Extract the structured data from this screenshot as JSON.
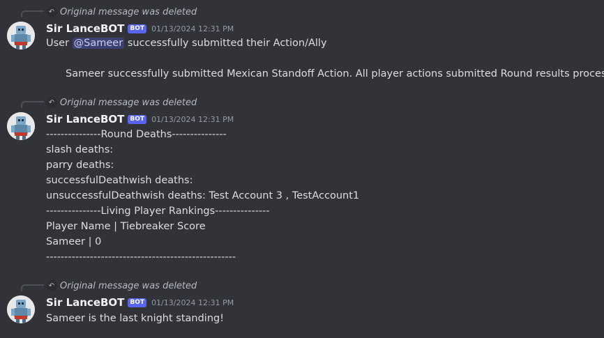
{
  "deleted_label": "Original message was deleted",
  "bot_tag": "BOT",
  "messages": [
    {
      "author": "Sir LanceBOT",
      "timestamp": "01/13/2024 12:31 PM",
      "intro_pre": "User",
      "mention": "@Sameer",
      "intro_post": "successfully submitted their Action/Ally",
      "detail": "Sameer successfully submitted Mexican Standoff Action. All player actions submitted Round results processed"
    },
    {
      "author": "Sir LanceBOT",
      "timestamp": "01/13/2024 12:31 PM",
      "lines": [
        "---------------Round Deaths---------------",
        "slash deaths:",
        "parry deaths:",
        "successfulDeathwish deaths:",
        "unsuccessfulDeathwish deaths:  Test Account 3 , TestAccount1",
        "---------------Living Player Rankings---------------",
        "Player Name | Tiebreaker Score",
        "Sameer | 0",
        "----------------------------------------------------"
      ]
    },
    {
      "author": "Sir LanceBOT",
      "timestamp": "01/13/2024 12:31 PM",
      "text": "Sameer is the last knight standing!"
    }
  ],
  "colors": {
    "background": "#313338",
    "text": "#dbdee1",
    "author": "#f2f3f5",
    "bot_tag": "#5865f2",
    "timestamp": "#949ba4",
    "mention_bg": "#5865f24d"
  },
  "icons": {
    "reply": "reply-arrow-icon",
    "avatar": "robot-knight-avatar"
  }
}
